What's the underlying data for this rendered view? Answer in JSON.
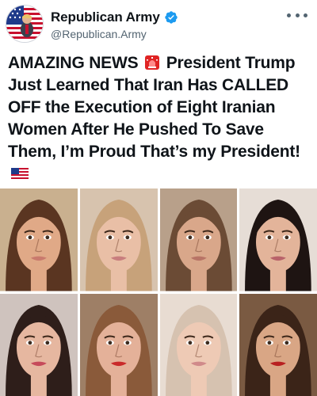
{
  "account": {
    "display_name": "Republican Army",
    "handle": "@Republican.Army",
    "verified": true,
    "avatar_icon": "eagle-flag-avatar",
    "more_icon": "more-options-icon"
  },
  "post": {
    "text_before_emoji": "AMAZING NEWS",
    "emoji_1": "police-siren-emoji",
    "text_after_emoji": " President Trump Just Learned That Iran Has CALLED OFF the Execution of Eight Iranian Women After He Pushed To Save Them, I’m Proud That’s my President!",
    "emoji_2": "us-flag-emoji"
  },
  "photos": [
    {
      "name": "woman-photo-1",
      "bg": "#c9b08f",
      "hair": "#5a3521",
      "skin": "#e0a987",
      "lips": "#c97a6d"
    },
    {
      "name": "woman-photo-2",
      "bg": "#d7c3ae",
      "hair": "#c7a27a",
      "skin": "#e9bfa6",
      "lips": "#c87e7e"
    },
    {
      "name": "woman-photo-3",
      "bg": "#b8a08a",
      "hair": "#6b4b35",
      "skin": "#d9a78a",
      "lips": "#b87466"
    },
    {
      "name": "woman-photo-4",
      "bg": "#e6ddd6",
      "hair": "#1e1412",
      "skin": "#e3b49a",
      "lips": "#b9636a"
    },
    {
      "name": "woman-photo-5",
      "bg": "#cfc3be",
      "hair": "#2e1e1a",
      "skin": "#e6b7a0",
      "lips": "#c64a5a"
    },
    {
      "name": "woman-photo-6",
      "bg": "#9e7f66",
      "hair": "#8a5a3a",
      "skin": "#e4b199",
      "lips": "#c92a2a"
    },
    {
      "name": "woman-photo-7",
      "bg": "#e8dcd2",
      "hair": "#d6c2b0",
      "skin": "#eecab5",
      "lips": "#d08a8a"
    },
    {
      "name": "woman-photo-8",
      "bg": "#7a5a42",
      "hair": "#3b2418",
      "skin": "#d9a685",
      "lips": "#b82020"
    }
  ],
  "colors": {
    "verified_blue": "#1d9bf0",
    "text_primary": "#0f1419",
    "text_secondary": "#536471"
  }
}
